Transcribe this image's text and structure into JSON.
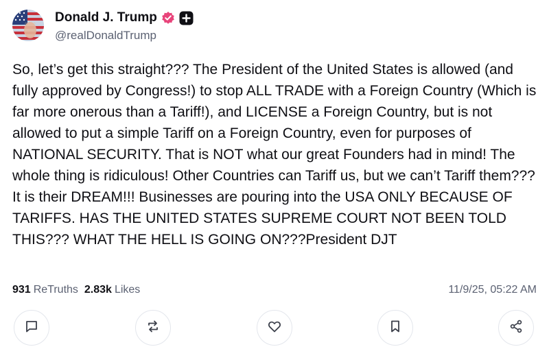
{
  "author": {
    "display_name": "Donald J. Trump",
    "handle": "@realDonaldTrump",
    "verified_color": "#e8447a"
  },
  "post": {
    "text": "So, let’s get this straight??? The President of the United States is allowed (and fully approved by Congress!) to stop ALL TRADE with a Foreign Country (Which is far more onerous than a Tariff!), and LICENSE a Foreign Country, but is not allowed to put a simple Tariff on a Foreign Country, even for purposes of NATIONAL SECURITY. That is NOT what our great Founders had in mind! The whole thing is ridiculous! Other Countries can Tariff us, but we can’t Tariff them??? It is their DREAM!!! Businesses are pouring into the USA ONLY BECAUSE OF TARIFFS. HAS THE UNITED STATES SUPREME COURT NOT BEEN TOLD THIS??? WHAT THE HELL IS GOING ON???President DJT",
    "retruths_count": "931",
    "retruths_label": "ReTruths",
    "likes_count": "2.83k",
    "likes_label": "Likes",
    "timestamp": "11/9/25, 05:22 AM"
  },
  "actions": [
    {
      "name": "reply",
      "icon": "comment-icon"
    },
    {
      "name": "retruth",
      "icon": "repost-icon"
    },
    {
      "name": "like",
      "icon": "heart-icon"
    },
    {
      "name": "bookmark",
      "icon": "bookmark-icon"
    },
    {
      "name": "share",
      "icon": "share-icon"
    }
  ]
}
